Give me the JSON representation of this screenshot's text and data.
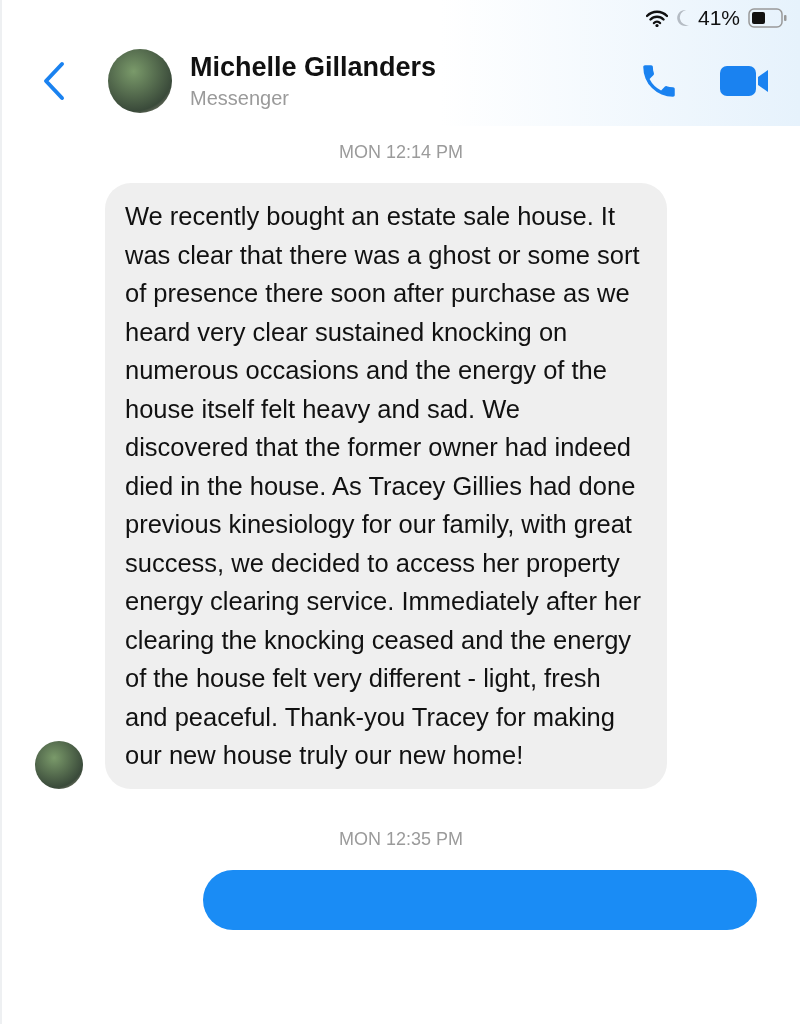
{
  "status_bar": {
    "battery_percent": "41%"
  },
  "header": {
    "name": "Michelle Gillanders",
    "subtitle": "Messenger"
  },
  "messages": [
    {
      "kind": "timestamp",
      "text": "MON 12:14 PM"
    },
    {
      "kind": "incoming",
      "text": "We recently bought an estate sale house. It was clear that there was a ghost or some sort of presence there soon after purchase as we heard very clear sustained knocking on numerous occasions and the energy of the house itself felt heavy and sad. We discovered that the former owner had indeed died in the house. As Tracey Gillies had done previous kinesiology for our family, with great success, we decided to access her property energy clearing service. Immediately after her clearing the knocking ceased and the energy of the house felt very different - light, fresh and peaceful. Thank-you Tracey for making our new house truly our new home!"
    },
    {
      "kind": "timestamp",
      "text": "MON 12:35 PM"
    },
    {
      "kind": "outgoing"
    }
  ]
}
